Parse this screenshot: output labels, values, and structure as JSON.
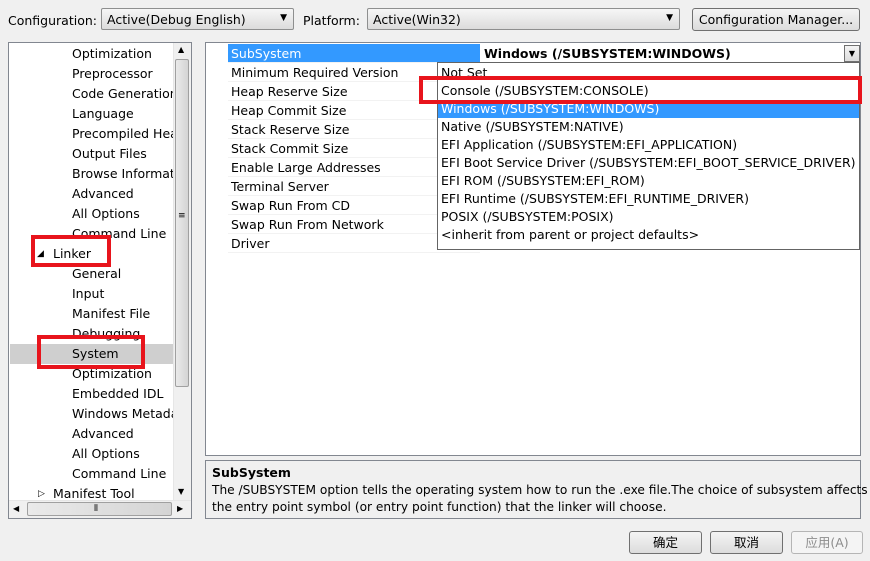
{
  "toolbar": {
    "configuration_label": "Configuration:",
    "configuration_value": "Active(Debug English)",
    "platform_label": "Platform:",
    "platform_value": "Active(Win32)",
    "config_manager_button": "Configuration Manager..."
  },
  "tree": {
    "items": [
      {
        "label": "Optimization"
      },
      {
        "label": "Preprocessor"
      },
      {
        "label": "Code Generation"
      },
      {
        "label": "Language"
      },
      {
        "label": "Precompiled Head"
      },
      {
        "label": "Output Files"
      },
      {
        "label": "Browse Informatio"
      },
      {
        "label": "Advanced"
      },
      {
        "label": "All Options"
      },
      {
        "label": "Command Line"
      },
      {
        "label": "Linker"
      },
      {
        "label": "General"
      },
      {
        "label": "Input"
      },
      {
        "label": "Manifest File"
      },
      {
        "label": "Debugging"
      },
      {
        "label": "System"
      },
      {
        "label": "Optimization"
      },
      {
        "label": "Embedded IDL"
      },
      {
        "label": "Windows Metada"
      },
      {
        "label": "Advanced"
      },
      {
        "label": "All Options"
      },
      {
        "label": "Command Line"
      },
      {
        "label": "Manifest Tool"
      }
    ],
    "selected": "System"
  },
  "properties": {
    "rows": [
      {
        "name": "SubSystem"
      },
      {
        "name": "Minimum Required Version"
      },
      {
        "name": "Heap Reserve Size"
      },
      {
        "name": "Heap Commit Size"
      },
      {
        "name": "Stack Reserve Size"
      },
      {
        "name": "Stack Commit Size"
      },
      {
        "name": "Enable Large Addresses"
      },
      {
        "name": "Terminal Server"
      },
      {
        "name": "Swap Run From CD"
      },
      {
        "name": "Swap Run From Network"
      },
      {
        "name": "Driver"
      }
    ],
    "subsystem_value": "Windows (/SUBSYSTEM:WINDOWS)"
  },
  "dropdown": {
    "options": [
      {
        "label": "Not Set"
      },
      {
        "label": "Console (/SUBSYSTEM:CONSOLE)"
      },
      {
        "label": "Windows (/SUBSYSTEM:WINDOWS)"
      },
      {
        "label": "Native (/SUBSYSTEM:NATIVE)"
      },
      {
        "label": "EFI Application (/SUBSYSTEM:EFI_APPLICATION)"
      },
      {
        "label": "EFI Boot Service Driver (/SUBSYSTEM:EFI_BOOT_SERVICE_DRIVER)"
      },
      {
        "label": "EFI ROM (/SUBSYSTEM:EFI_ROM)"
      },
      {
        "label": "EFI Runtime (/SUBSYSTEM:EFI_RUNTIME_DRIVER)"
      },
      {
        "label": "POSIX (/SUBSYSTEM:POSIX)"
      },
      {
        "label": "<inherit from parent or project defaults>"
      }
    ],
    "selected": "Windows (/SUBSYSTEM:WINDOWS)"
  },
  "description": {
    "title": "SubSystem",
    "text_line1": "The /SUBSYSTEM option tells the operating system how to run the .exe file.The choice of subsystem affects",
    "text_line2": "the entry point symbol (or entry point function) that the linker will choose."
  },
  "buttons": {
    "ok": "确定",
    "cancel": "取消",
    "apply": "应用(A)"
  },
  "colors": {
    "highlight": "#3399ff",
    "annotation_red": "#e8141c"
  }
}
